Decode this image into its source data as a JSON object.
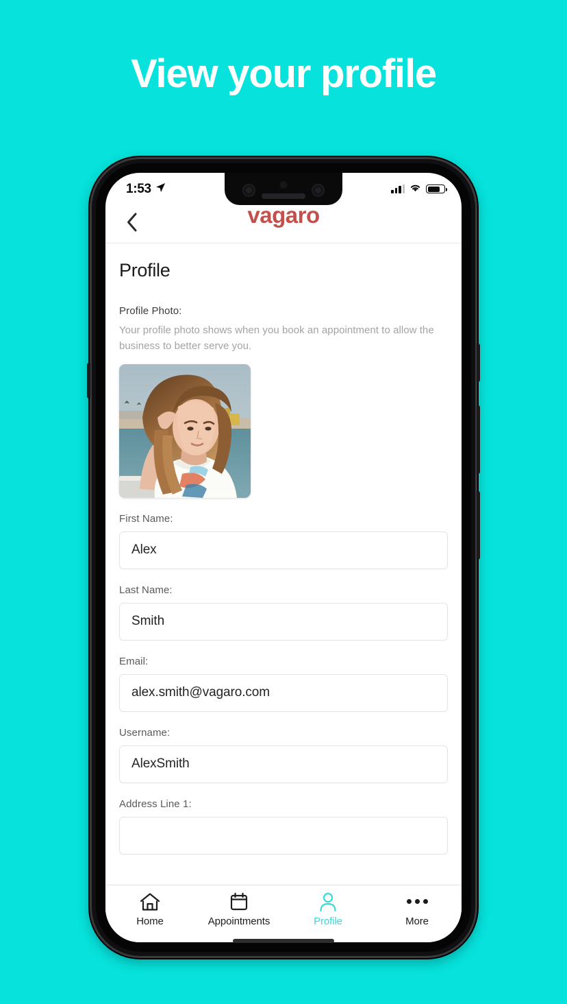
{
  "page": {
    "headline": "View your profile",
    "background_color": "#07e2dc"
  },
  "phone": {
    "status_bar": {
      "time": "1:53",
      "location_icon": "location-arrow-icon",
      "signal_icon": "cellular-signal-icon",
      "wifi_icon": "wifi-icon",
      "battery_icon": "battery-icon",
      "battery_level": "74%"
    },
    "home_indicator": "home-indicator"
  },
  "app": {
    "header": {
      "back_icon": "chevron-left-icon",
      "brand": "vagaro",
      "brand_color": "#c4504c"
    },
    "screen": {
      "title": "Profile",
      "photo_section": {
        "label": "Profile Photo:",
        "description": "Your profile photo shows when you book an appointment to allow the business to better serve you.",
        "image_alt": "user-profile-photo"
      },
      "fields": [
        {
          "label": "First Name:",
          "value": "Alex",
          "placeholder": ""
        },
        {
          "label": "Last Name:",
          "value": "Smith",
          "placeholder": ""
        },
        {
          "label": "Email:",
          "value": "alex.smith@vagaro.com",
          "placeholder": ""
        },
        {
          "label": "Username:",
          "value": "AlexSmith",
          "placeholder": ""
        },
        {
          "label": "Address Line 1:",
          "value": "",
          "placeholder": ""
        }
      ]
    },
    "tabbar": {
      "active_color": "#3ad9d9",
      "tabs": [
        {
          "label": "Home",
          "icon": "home-icon",
          "active": false
        },
        {
          "label": "Appointments",
          "icon": "calendar-icon",
          "active": false
        },
        {
          "label": "Profile",
          "icon": "person-icon",
          "active": true
        },
        {
          "label": "More",
          "icon": "ellipsis-icon",
          "active": false
        }
      ]
    }
  }
}
